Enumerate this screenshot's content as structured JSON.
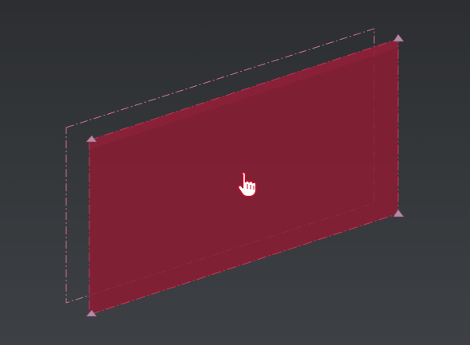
{
  "viewport": {
    "background_top": "#2c2e31",
    "background_bottom": "#3d4044"
  },
  "plane": {
    "fill_color": "#8a1c33",
    "fill_opacity": 0.85,
    "edge_color": "#c73a5a",
    "ghost_outline_color": "#e07a95",
    "vertex_handle_color": "#b58aa6"
  },
  "cursor": {
    "icon": "hand-pointer-icon",
    "fill": "#ffffff",
    "outline": "#c0102a"
  }
}
